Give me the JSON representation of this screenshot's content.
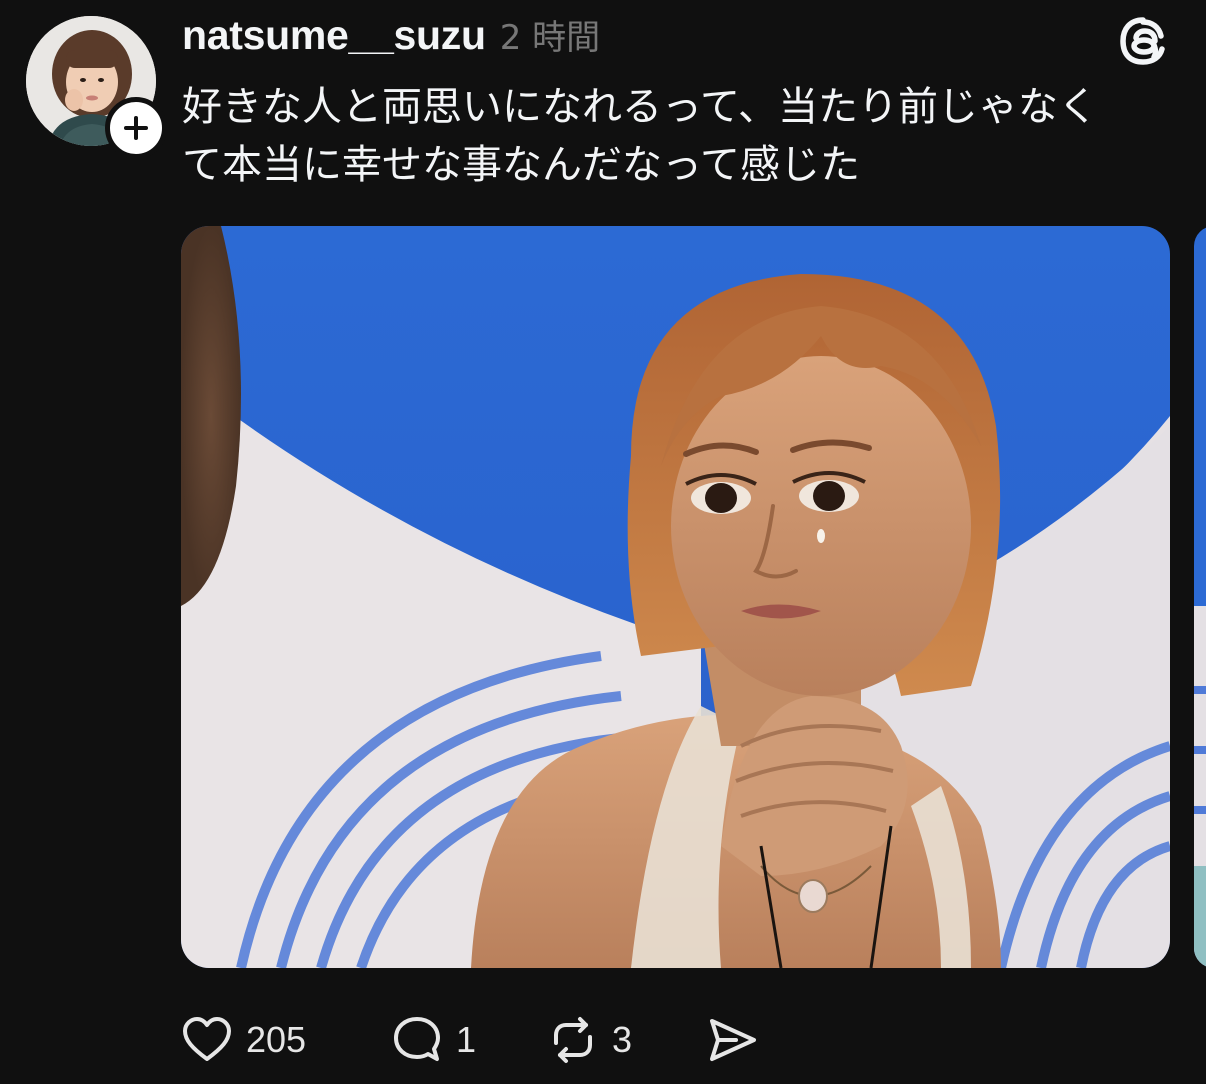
{
  "post": {
    "username": "natsume__suzu",
    "timestamp": "2 時間",
    "text_line1": "好きな人と両思いになれるって、当たり前じゃなく",
    "text_line2": "て本当に幸せな事なんだなって感じた"
  },
  "actions": {
    "likes": "205",
    "replies": "1",
    "reposts": "3"
  },
  "icons": {
    "like": "heart-icon",
    "reply": "speech-bubble-icon",
    "repost": "repost-arrows-icon",
    "share": "send-icon",
    "follow": "plus-icon",
    "brand": "threads-logo-icon"
  },
  "colors": {
    "background": "#101010",
    "text_primary": "#f3f5f7",
    "text_secondary": "#777777"
  }
}
